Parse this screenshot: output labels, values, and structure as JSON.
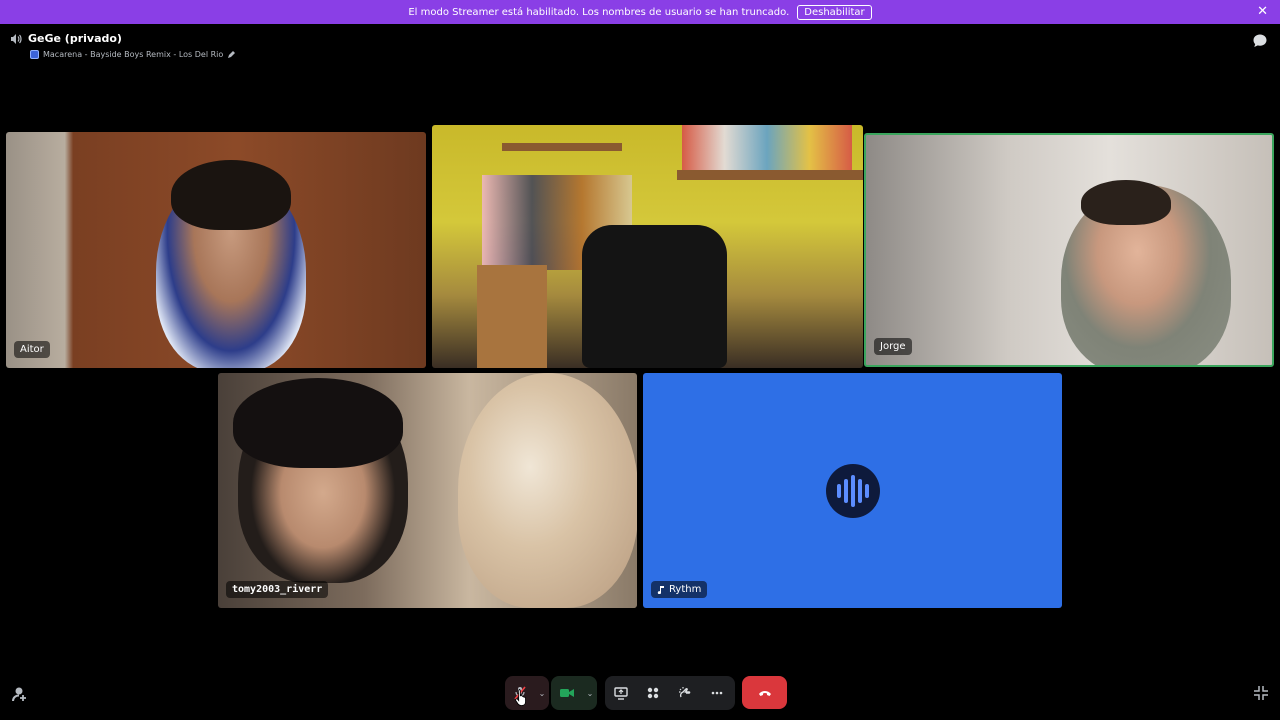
{
  "banner": {
    "text": "El modo Streamer está habilitado. Los nombres de usuario se han truncado.",
    "button_label": "Deshabilitar",
    "close_icon": "close-icon",
    "color": "#8a3fe6"
  },
  "header": {
    "channel_name": "GeGe (privado)",
    "activity_text": "Macarena - Bayside Boys Remix - Los Del Rio",
    "speaker_icon": "speaker-icon",
    "edit_icon": "pencil-icon",
    "chat_icon": "chat-bubble-icon"
  },
  "participants": [
    {
      "name": "Aitor",
      "video": true
    },
    {
      "name": "",
      "video": true
    },
    {
      "name": "Jorge",
      "video": true,
      "speaking": true
    },
    {
      "name": "tomy2003_riverr",
      "video": true
    },
    {
      "name": "Rythm",
      "video": false,
      "bot": true,
      "tile_color": "#2e6fe6"
    }
  ],
  "controls": {
    "mic_icon": "microphone-muted-icon",
    "camera_icon": "camera-icon",
    "screen_share_icon": "screen-share-icon",
    "activities_icon": "activities-icon",
    "soundboard_icon": "soundboard-icon",
    "more_icon": "more-icon",
    "disconnect_icon": "phone-hangup-icon",
    "invite_icon": "add-user-icon",
    "fullscreen_icon": "exit-fullscreen-icon"
  },
  "colors": {
    "speaking_border": "#3ba55d",
    "hangup": "#da373c",
    "camera_on": "#23a55a",
    "mic_muted": "#f23f43"
  }
}
